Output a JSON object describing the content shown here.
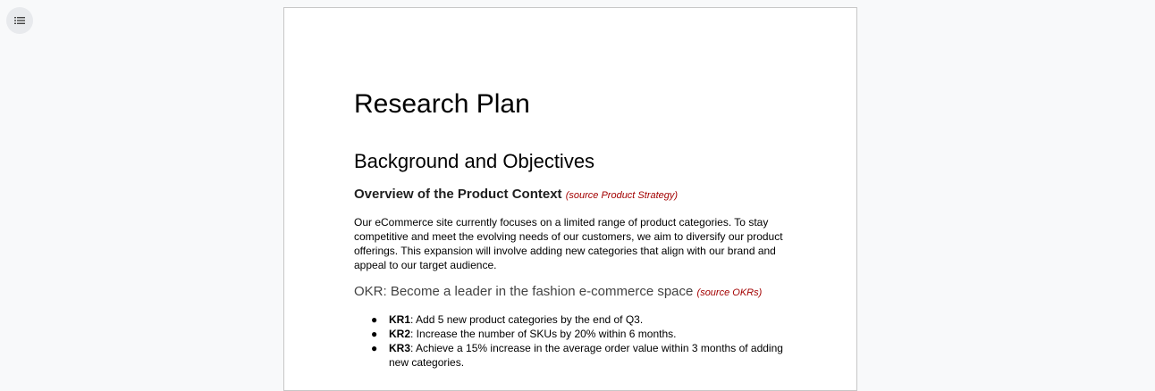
{
  "outline_button": {
    "icon": "list-outline-icon",
    "tooltip": ""
  },
  "document": {
    "title": "Research Plan",
    "heading1": "Background and Objectives",
    "overview": {
      "heading": "Overview of the Product Context",
      "source": "(source Product Strategy)",
      "paragraph_lines": [
        "Our eCommerce site currently focuses on a limited range of product categories. To stay",
        "competitive and meet the evolving needs of our customers, we aim to diversify our product",
        "offerings. This expansion will involve adding new categories that align with our brand and",
        "appeal to our target audience."
      ]
    },
    "okr": {
      "heading": "OKR: Become a leader in the fashion e-commerce space",
      "source": "(source OKRs)",
      "key_results": [
        {
          "label": "KR1",
          "lines": [
            ": Add 5 new product categories by the end of Q3."
          ]
        },
        {
          "label": "KR2",
          "lines": [
            ": Increase the number of SKUs by 20% within 6 months."
          ]
        },
        {
          "label": "KR3",
          "lines": [
            ": Achieve a 15% increase in the average order value within 3 months of adding",
            "new categories."
          ]
        }
      ]
    }
  },
  "colors": {
    "background": "#f8f9fa",
    "page": "#ffffff",
    "source_text": "#a30000"
  }
}
